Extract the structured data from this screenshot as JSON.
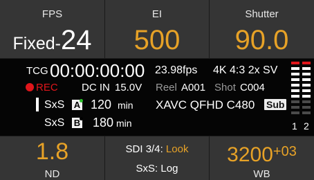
{
  "fps": {
    "label": "FPS",
    "mode": "Fixed-",
    "value": "24"
  },
  "ei": {
    "label": "EI",
    "value": "500"
  },
  "shutter": {
    "label": "Shutter",
    "value": "90.0"
  },
  "status": {
    "tcg_label": "TCG",
    "timecode": "00:00:00:00",
    "frame_rate": "23.98fps",
    "format": "4K 4:3 2x SV",
    "rec": "REC",
    "dc_label": "DC IN",
    "dc_value": "15.0V",
    "reel_label": "Reel",
    "reel_value": "A001",
    "shot_label": "Shot",
    "shot_value": "C004",
    "codec": "XAVC QFHD C480",
    "sub_badge": "Sub",
    "media": [
      {
        "type": "SxS",
        "slot": "A",
        "value": "120",
        "unit": "min",
        "dot_color": "#2bc02b"
      },
      {
        "type": "SxS",
        "slot": "B",
        "value": "180",
        "unit": "min",
        "dot_color": "#000000"
      }
    ],
    "meter_channels": [
      "1",
      "2"
    ]
  },
  "nd": {
    "value": "1.8",
    "label": "ND"
  },
  "sdi": {
    "label": "SDI 3/4:",
    "value": "Look",
    "sxs_label": "SxS:",
    "sxs_value": "Log"
  },
  "wb": {
    "value": "3200",
    "offset": "+03",
    "label": "WB"
  },
  "colors": {
    "accent": "#e7a227",
    "rec": "#e0161b",
    "panel": "#353535"
  }
}
